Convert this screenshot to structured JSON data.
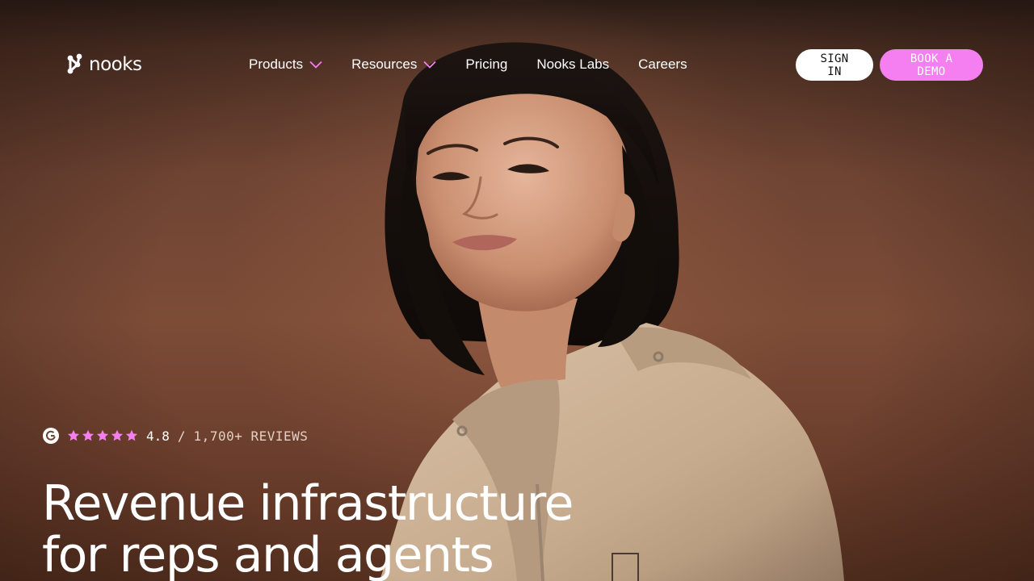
{
  "brand": {
    "name": "nooks"
  },
  "nav": {
    "items": [
      {
        "label": "Products",
        "has_dropdown": true
      },
      {
        "label": "Resources",
        "has_dropdown": true
      },
      {
        "label": "Pricing",
        "has_dropdown": false
      },
      {
        "label": "Nooks Labs",
        "has_dropdown": false
      },
      {
        "label": "Careers",
        "has_dropdown": false
      }
    ],
    "sign_in_label": "SIGN IN",
    "book_demo_label": "BOOK A DEMO"
  },
  "rating": {
    "icon": "g2-icon",
    "stars": 5,
    "score": "4.8",
    "separator": "/",
    "count_label": "1,700+ REVIEWS"
  },
  "hero": {
    "headline_line1": "Revenue infrastructure",
    "headline_line2": "for reps and agents"
  },
  "colors": {
    "accent_pink": "#f57ff0",
    "background_brown": "#7c4c37",
    "text_white": "#ffffff"
  }
}
